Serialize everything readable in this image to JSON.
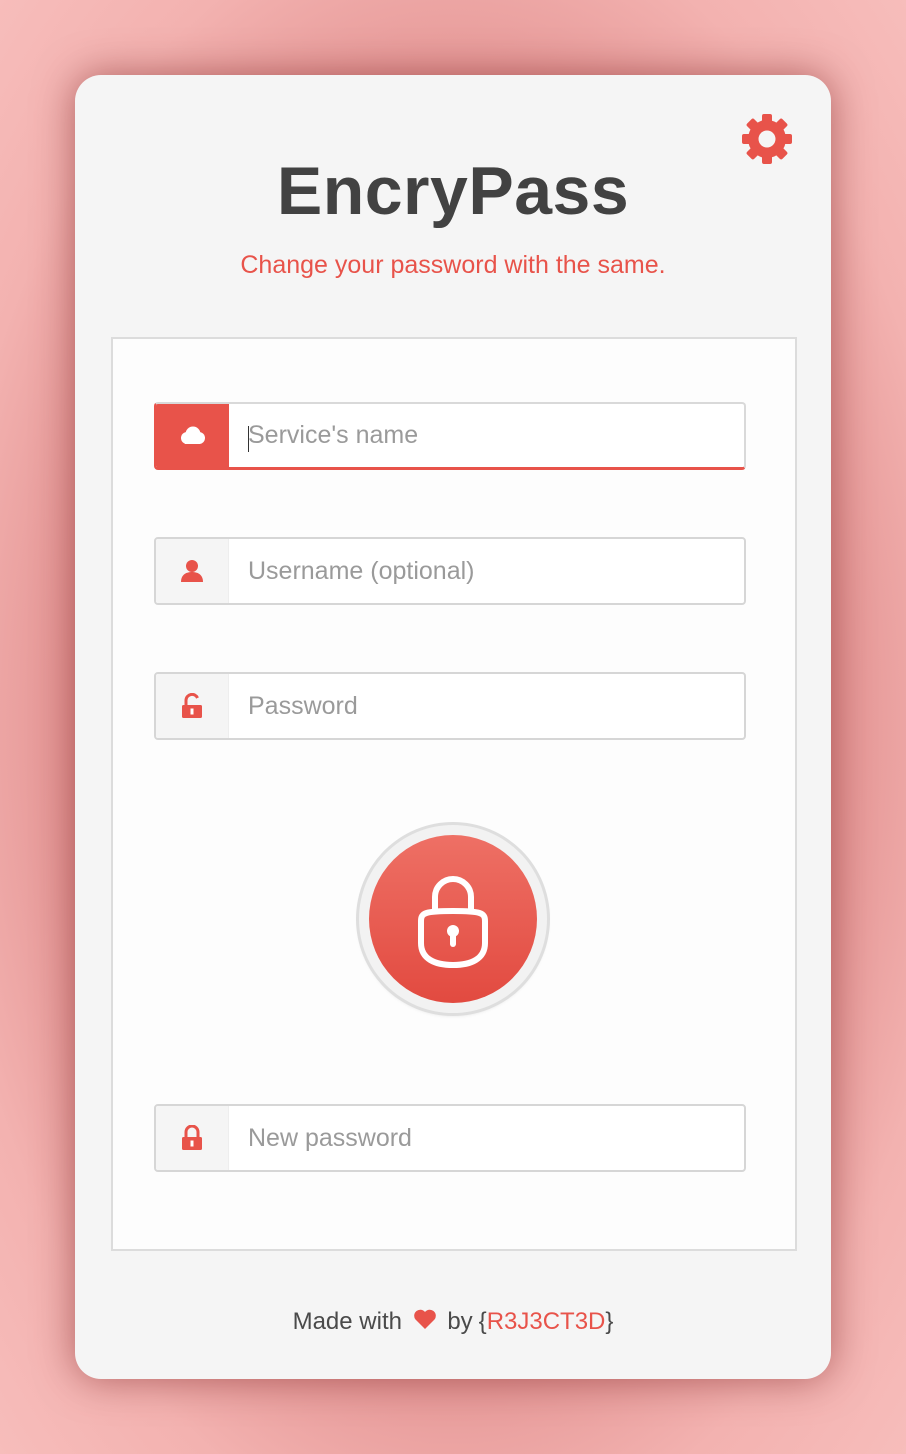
{
  "app": {
    "title": "EncryPass",
    "subtitle": "Change your password with the same."
  },
  "colors": {
    "accent": "#e8534a",
    "title": "#424242",
    "background": "#f5f5f5"
  },
  "header": {
    "settings_icon": "gear-icon"
  },
  "form": {
    "service": {
      "placeholder": "Service's name",
      "value": "",
      "icon": "cloud-icon"
    },
    "username": {
      "placeholder": "Username (optional)",
      "value": "",
      "icon": "user-icon"
    },
    "password": {
      "placeholder": "Password",
      "value": "",
      "icon": "unlock-icon"
    },
    "new_password": {
      "placeholder": "New password",
      "value": "",
      "icon": "lock-icon"
    }
  },
  "action": {
    "icon": "padlock-icon"
  },
  "footer": {
    "made_with": "Made with",
    "heart_icon": "heart-icon",
    "by": "by",
    "brace_open": "{",
    "author": "R3J3CT3D",
    "brace_close": "}"
  }
}
